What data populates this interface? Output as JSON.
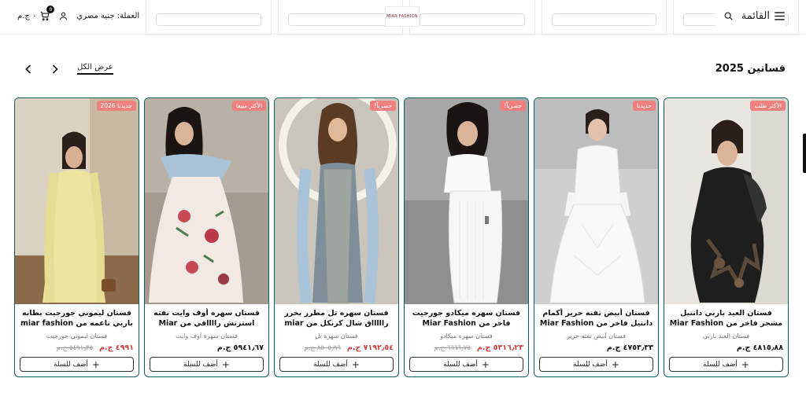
{
  "header": {
    "menu_label": "القائمة",
    "currency_label": "العملة: جنيه مصري",
    "cart_total": "٠ ج.م",
    "cart_count": "0",
    "logo_text": "MIAR FASHION"
  },
  "section": {
    "title": "فساتين 2025",
    "view_all": "عرض الكل"
  },
  "products": [
    {
      "badge": "الأكثر طلب",
      "title": "فستان العيد باربي دانتيل مشجر فاخر من Miar Fashion",
      "subtitle": "فستان العيد باربي",
      "price": "٤٨١٥٫٨٨ ج.م",
      "old_price": "",
      "on_sale": false,
      "add_label": "أضف للسلة"
    },
    {
      "badge": "جديدنا",
      "title": "فستان أبيض تفته حرير أكمام دانتيل فاخر من Miar Fashion",
      "subtitle": "فستان أبيض تفته حرير",
      "price": "٤٧٥٣٫٣٣ ج.م",
      "old_price": "",
      "on_sale": false,
      "add_label": "أضف للسلة"
    },
    {
      "badge": "حصرياً!",
      "title": "فستان سهره ميكادو جورجيت فاخر من Miar Fashion",
      "subtitle": "فستان سهره ميكادو",
      "price": "٥٣١٦٫٢٣ ج.م",
      "old_price": "٦٦٦٦٫٧٥ ج.م",
      "on_sale": true,
      "add_label": "أضف للسلة"
    },
    {
      "badge": "حصرياً!",
      "title": "فستان سهره تل مطرز بخرز راااااق شال كرنكل من miar fashion",
      "subtitle": "فستان سهره تل",
      "price": "٧١٩٢٫٥٤ ج.م",
      "old_price": "٨٥٠٥٫٩٦ ج.م",
      "on_sale": true,
      "add_label": "أضف للسلة"
    },
    {
      "badge": "الأكثر مبيعا",
      "title": "فستان سهره أوف وايت تفته استرتش رااااقي من Miar fashion",
      "subtitle": "فستان سهره أوف وايت",
      "price": "٥٩٤١٫٦٧ ج.م",
      "old_price": "",
      "on_sale": false,
      "add_label": "أضف للسلة"
    },
    {
      "badge": "جديدنا 2026",
      "title": "فستان ليموني جورجيت بطانه باربي ناعمه من miar fashion",
      "subtitle": "فستان ليموني جورجيت",
      "price": "٤٩٩١ ج.م",
      "old_price": "٥٤٩١٫٣٥ ج.م",
      "on_sale": true,
      "add_label": "أضف للسلة"
    }
  ]
}
